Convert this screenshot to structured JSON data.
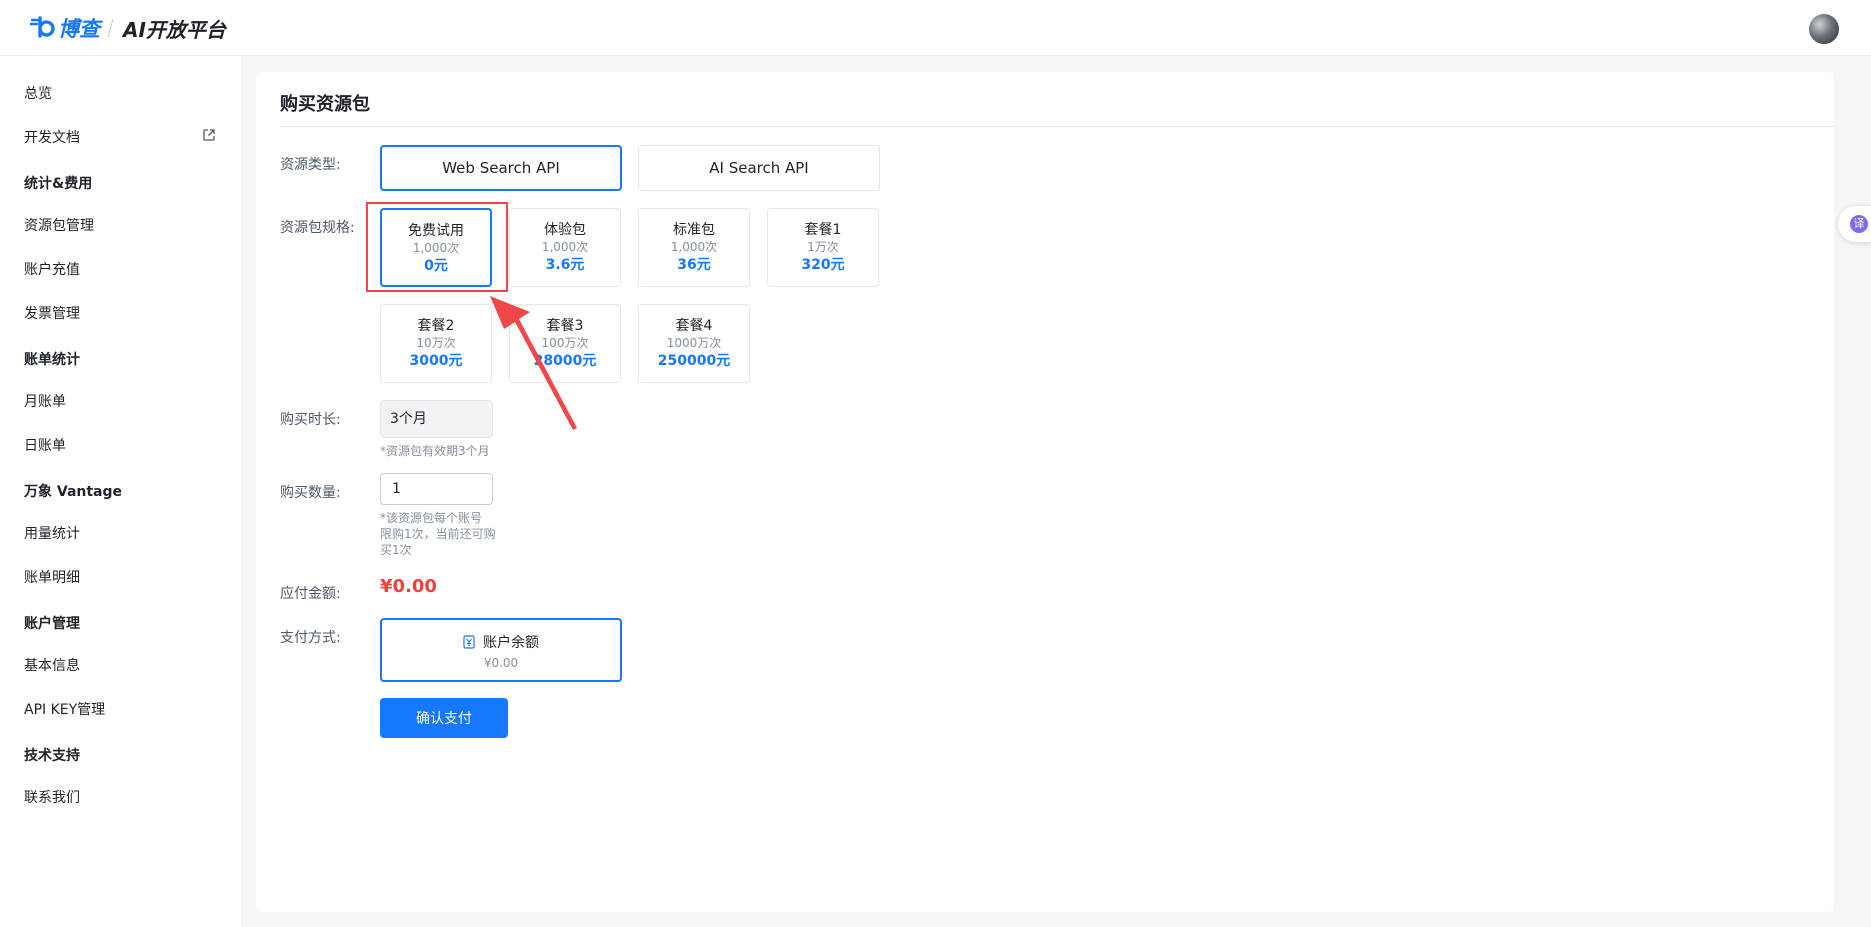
{
  "header": {
    "brand": "博查",
    "platform": "AI开放平台"
  },
  "sidebar": {
    "items": [
      {
        "label": "总览",
        "group": false
      },
      {
        "label": "开发文档",
        "group": false
      },
      {
        "label": "统计&费用",
        "group": true
      },
      {
        "label": "资源包管理",
        "group": false
      },
      {
        "label": "账户充值",
        "group": false
      },
      {
        "label": "发票管理",
        "group": false
      },
      {
        "label": "账单统计",
        "group": true
      },
      {
        "label": "月账单",
        "group": false
      },
      {
        "label": "日账单",
        "group": false
      },
      {
        "label": "万象 Vantage",
        "group": true
      },
      {
        "label": "用量统计",
        "group": false
      },
      {
        "label": "账单明细",
        "group": false
      },
      {
        "label": "账户管理",
        "group": true
      },
      {
        "label": "基本信息",
        "group": false
      },
      {
        "label": "API KEY管理",
        "group": false
      },
      {
        "label": "技术支持",
        "group": true
      },
      {
        "label": "联系我们",
        "group": false
      }
    ]
  },
  "main": {
    "title": "购买资源包",
    "resource_type": {
      "label": "资源类型:",
      "options": [
        "Web Search API",
        "AI Search API"
      ],
      "selected": "Web Search API"
    },
    "spec": {
      "label": "资源包规格:",
      "packages": [
        {
          "name": "免费试用",
          "quota": "1,000次",
          "price": "0元"
        },
        {
          "name": "体验包",
          "quota": "1,000次",
          "price": "3.6元"
        },
        {
          "name": "标准包",
          "quota": "1,000次",
          "price": "36元"
        },
        {
          "name": "套餐1",
          "quota": "1万次",
          "price": "320元"
        },
        {
          "name": "套餐2",
          "quota": "10万次",
          "price": "3000元"
        },
        {
          "name": "套餐3",
          "quota": "100万次",
          "price": "28000元"
        },
        {
          "name": "套餐4",
          "quota": "1000万次",
          "price": "250000元"
        }
      ],
      "selected": "免费试用"
    },
    "duration": {
      "label": "购买时长:",
      "value": "3个月",
      "hint": "*资源包有效期3个月"
    },
    "quantity": {
      "label": "购买数量:",
      "value": "1",
      "hint_lines": [
        "*该资源包每个账号",
        "限购1次，当前还可购",
        "买1次"
      ]
    },
    "amount": {
      "label": "应付金额:",
      "value": "¥0.00"
    },
    "payment": {
      "label": "支付方式:",
      "method": "账户余额",
      "balance": "¥0.00"
    },
    "confirm_label": "确认支付"
  },
  "floating": {
    "translate_glyph": "译"
  },
  "colors": {
    "accent": "#1677ff",
    "price": "#1677ff",
    "amount": "#f53f3f",
    "annotation": "#f04848"
  }
}
